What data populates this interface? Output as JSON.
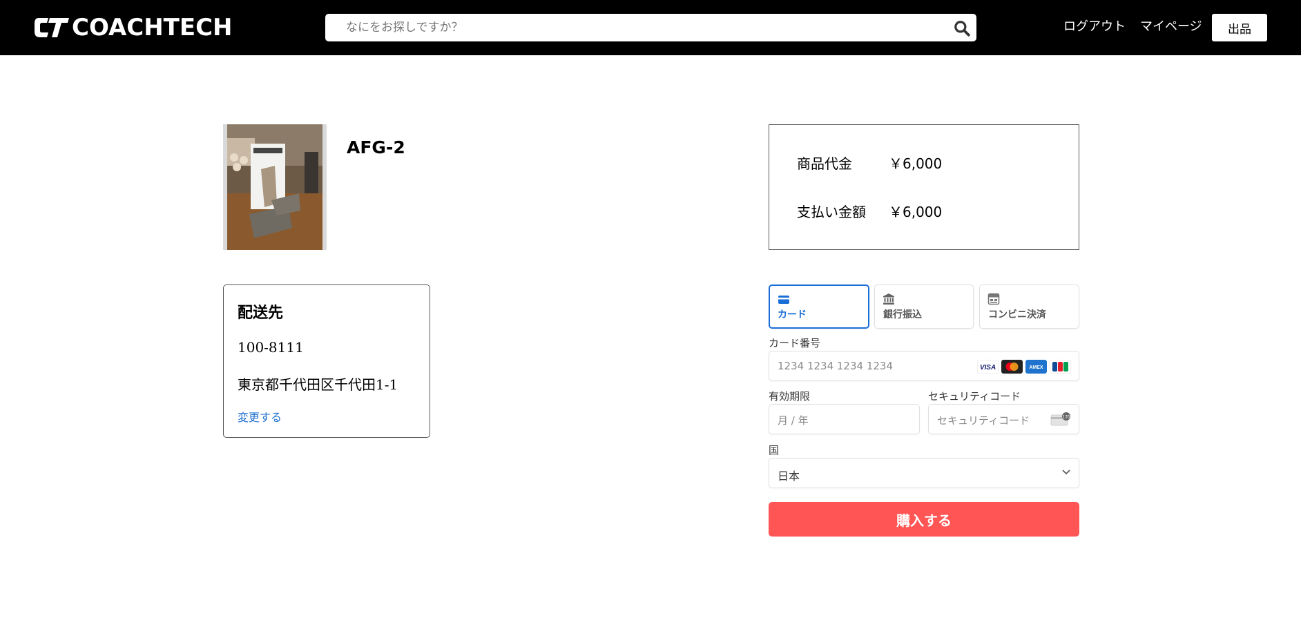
{
  "header": {
    "logo_text": "COACHTECH",
    "search_placeholder": "なにをお探しですか？",
    "nav": {
      "logout": "ログアウト",
      "mypage": "マイページ",
      "sell": "出品"
    }
  },
  "product": {
    "name": "AFG-2",
    "image_alt": "AFG-2"
  },
  "shipping": {
    "title": "配送先",
    "postal_code": "100-8111",
    "address": "東京都千代田区千代田1-1",
    "change_link": "変更する"
  },
  "summary": {
    "item_price_label": "商品代金",
    "item_price_value": "￥6,000",
    "total_label": "支払い金額",
    "total_value": "￥6,000"
  },
  "payment": {
    "tabs": [
      {
        "label": "カード",
        "icon": "credit-card-icon",
        "active": true
      },
      {
        "label": "銀行振込",
        "icon": "bank-icon",
        "active": false
      },
      {
        "label": "コンビニ決済",
        "icon": "store-icon",
        "active": false
      }
    ],
    "card_number_label": "カード番号",
    "card_number_placeholder": "1234 1234 1234 1234",
    "card_brands": [
      "visa-icon",
      "mastercard-icon",
      "amex-icon",
      "jcb-icon"
    ],
    "expiry_label": "有効期限",
    "expiry_placeholder": "月 / 年",
    "cvc_label": "セキュリティコード",
    "cvc_placeholder": "セキュリティコード",
    "country_label": "国",
    "country_value": "日本",
    "colors": {
      "active_tab": "#1a6ed8",
      "buy_button": "#ff5555",
      "link": "#1f6fd1"
    }
  },
  "buy_button": "購入する"
}
